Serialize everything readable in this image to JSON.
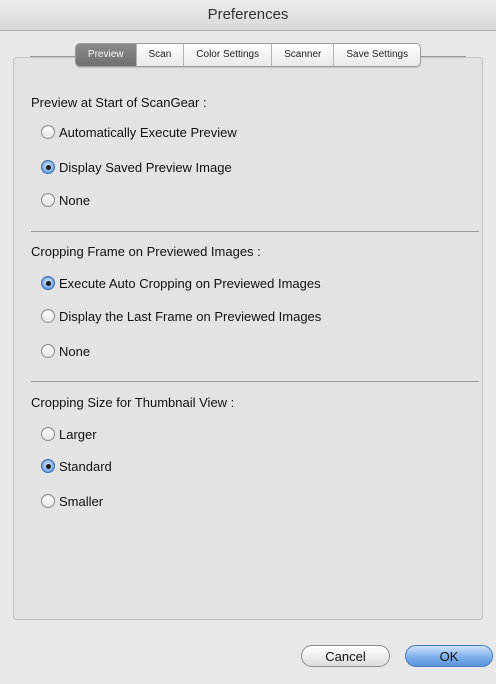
{
  "window": {
    "title": "Preferences"
  },
  "tabs": [
    {
      "label": "Preview",
      "active": true
    },
    {
      "label": "Scan",
      "active": false
    },
    {
      "label": "Color Settings",
      "active": false
    },
    {
      "label": "Scanner",
      "active": false
    },
    {
      "label": "Save Settings",
      "active": false
    }
  ],
  "sections": [
    {
      "title": "Preview at Start of ScanGear :",
      "options": [
        {
          "label": "Automatically Execute Preview",
          "selected": false
        },
        {
          "label": "Display Saved Preview Image",
          "selected": true
        },
        {
          "label": "None",
          "selected": false
        }
      ]
    },
    {
      "title": "Cropping Frame on Previewed Images :",
      "options": [
        {
          "label": "Execute Auto Cropping on Previewed Images",
          "selected": true
        },
        {
          "label": "Display the Last Frame on Previewed Images",
          "selected": false
        },
        {
          "label": "None",
          "selected": false
        }
      ]
    },
    {
      "title": "Cropping Size for Thumbnail View :",
      "options": [
        {
          "label": "Larger",
          "selected": false
        },
        {
          "label": "Standard",
          "selected": true
        },
        {
          "label": "Smaller",
          "selected": false
        }
      ]
    }
  ],
  "buttons": {
    "cancel": "Cancel",
    "ok": "OK"
  },
  "colors": {
    "accent": "#5a93dc",
    "active_tab": "#7a7a7a"
  }
}
